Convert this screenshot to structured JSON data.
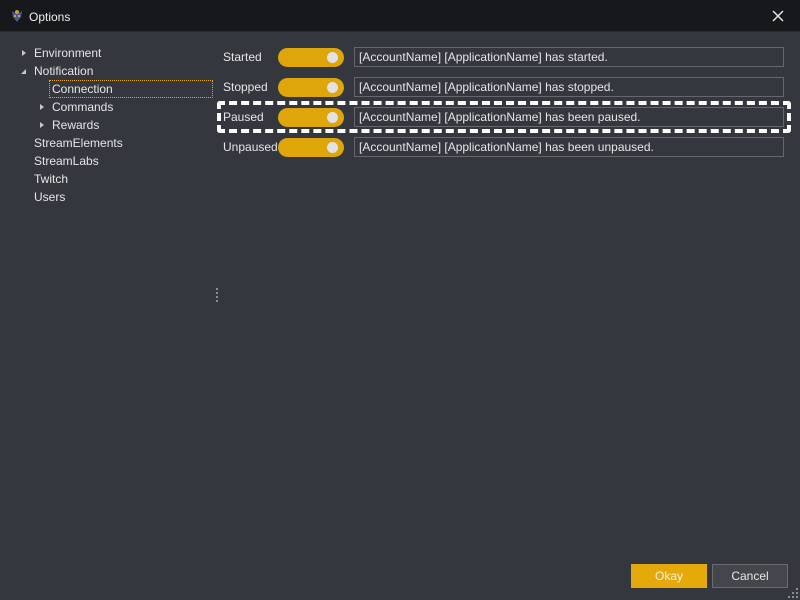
{
  "window": {
    "title": "Options",
    "app_icon": "app-logo-icon",
    "close_icon": "close-icon"
  },
  "tree": {
    "items": [
      {
        "label": "Environment",
        "level": 0,
        "expander": "collapsed"
      },
      {
        "label": "Notification",
        "level": 0,
        "expander": "expanded"
      },
      {
        "label": "Connection",
        "level": 1,
        "expander": "none",
        "selected": true
      },
      {
        "label": "Commands",
        "level": 1,
        "expander": "collapsed"
      },
      {
        "label": "Rewards",
        "level": 1,
        "expander": "collapsed"
      },
      {
        "label": "StreamElements",
        "level": 0,
        "expander": "none"
      },
      {
        "label": "StreamLabs",
        "level": 0,
        "expander": "none"
      },
      {
        "label": "Twitch",
        "level": 0,
        "expander": "none"
      },
      {
        "label": "Users",
        "level": 0,
        "expander": "none"
      }
    ]
  },
  "settings": {
    "rows": [
      {
        "label": "Started",
        "enabled": true,
        "message": "[AccountName] [ApplicationName] has started."
      },
      {
        "label": "Stopped",
        "enabled": true,
        "message": "[AccountName] [ApplicationName] has stopped."
      },
      {
        "label": "Paused",
        "enabled": true,
        "message": "[AccountName] [ApplicationName] has been paused.",
        "highlighted": true
      },
      {
        "label": "Unpaused",
        "enabled": true,
        "message": "[AccountName] [ApplicationName] has been unpaused."
      }
    ]
  },
  "footer": {
    "okay_label": "Okay",
    "cancel_label": "Cancel"
  },
  "colors": {
    "accent": "#e5a90c",
    "background": "#35373e",
    "titlebar": "#17181c",
    "input_border": "#65676d"
  }
}
